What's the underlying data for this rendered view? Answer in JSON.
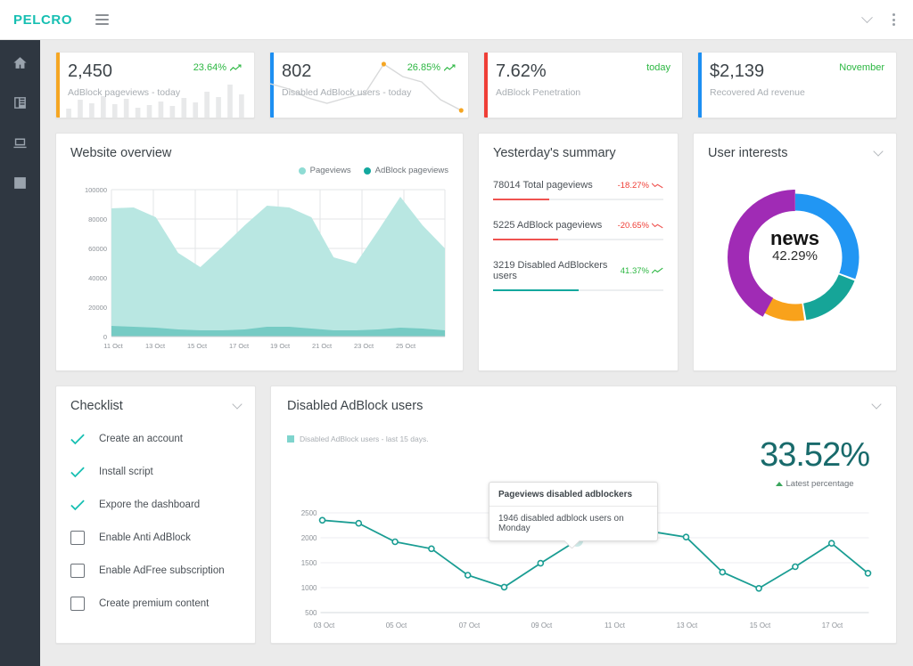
{
  "topbar": {
    "brand": "PELCRO",
    "menu_icon": "hamburger-icon",
    "chevron_icon": "chevron-down-icon",
    "kebab_icon": "more-vertical-icon"
  },
  "sidebar": {
    "items": [
      {
        "icon": "home-icon",
        "name": "sidebar-item-home"
      },
      {
        "icon": "list-icon",
        "name": "sidebar-item-content"
      },
      {
        "icon": "laptop-icon",
        "name": "sidebar-item-sites"
      },
      {
        "icon": "chart-icon",
        "name": "sidebar-item-analytics"
      }
    ]
  },
  "kpis": [
    {
      "value": "2,450",
      "delta": "23.64%",
      "delta_dir": "up",
      "label": "AdBlock pageviews - today",
      "accent": "#f5a623",
      "spark": "bars"
    },
    {
      "value": "802",
      "delta": "26.85%",
      "delta_dir": "up",
      "label": "Disabled AdBlock users - today",
      "accent": "#1d8ff2",
      "spark": "line"
    },
    {
      "value": "7.62%",
      "delta": "today",
      "delta_dir": "none",
      "label": "AdBlock Penetration",
      "accent": "#ef3e36",
      "spark": "none"
    },
    {
      "value": "$2,139",
      "delta": "November",
      "delta_dir": "none",
      "label": "Recovered Ad revenue",
      "accent": "#1d8ff2",
      "spark": "none"
    }
  ],
  "overview": {
    "title": "Website overview",
    "legend": [
      {
        "label": "Pageviews",
        "color": "#8fdcd4"
      },
      {
        "label": "AdBlock pageviews",
        "color": "#13a89e"
      }
    ]
  },
  "summary": {
    "title": "Yesterday's summary",
    "rows": [
      {
        "text": "78014 Total pageviews",
        "delta": "-18.27%",
        "dir": "down",
        "color": "#ef5350",
        "progress": 33
      },
      {
        "text": "5225 AdBlock pageviews",
        "delta": "-20.65%",
        "dir": "down",
        "color": "#ef5350",
        "progress": 38
      },
      {
        "text": "3219 Disabled AdBlockers users",
        "delta": "41.37%",
        "dir": "up",
        "color": "#13a89e",
        "progress": 50
      }
    ]
  },
  "interests": {
    "title": "User interests",
    "chevron_icon": "chevron-down-icon",
    "center_label": "news",
    "center_value": "42.29%"
  },
  "checklist": {
    "title": "Checklist",
    "chevron_icon": "chevron-down-icon",
    "items": [
      {
        "label": "Create an account",
        "done": true
      },
      {
        "label": "Install script",
        "done": true
      },
      {
        "label": "Expore the dashboard",
        "done": true
      },
      {
        "label": "Enable Anti AdBlock",
        "done": false
      },
      {
        "label": "Enable AdFree subscription",
        "done": false
      },
      {
        "label": "Create premium content",
        "done": false
      }
    ]
  },
  "adblock": {
    "title": "Disabled AdBlock users",
    "chevron_icon": "chevron-down-icon",
    "legend_label": "Disabled AdBlock users - last 15 days.",
    "percentage": "33.52%",
    "percentage_caption": "Latest percentage",
    "tooltip_title": "Pageviews disabled adblockers",
    "tooltip_body": "1946 disabled adblock users on Monday"
  },
  "chart_data": [
    {
      "type": "area",
      "title": "Website overview",
      "x": [
        "11 Oct",
        "12 Oct",
        "13 Oct",
        "14 Oct",
        "15 Oct",
        "16 Oct",
        "17 Oct",
        "18 Oct",
        "19 Oct",
        "20 Oct",
        "21 Oct",
        "22 Oct",
        "23 Oct",
        "24 Oct",
        "25 Oct",
        "26 Oct"
      ],
      "tick_labels": [
        "11 Oct",
        "13 Oct",
        "15 Oct",
        "17 Oct",
        "19 Oct",
        "21 Oct",
        "23 Oct",
        "25 Oct"
      ],
      "ylim": [
        0,
        100000
      ],
      "yticks": [
        0,
        20000,
        40000,
        60000,
        80000,
        100000
      ],
      "grid": true,
      "legend_position": "top-right",
      "xlabel": "",
      "ylabel": "",
      "series": [
        {
          "name": "Pageviews",
          "color": "#b9e7e2",
          "values": [
            87000,
            88000,
            81000,
            57000,
            47000,
            61000,
            76000,
            89000,
            88000,
            81000,
            54000,
            50000,
            72000,
            95000,
            76000,
            60000
          ]
        },
        {
          "name": "AdBlock pageviews",
          "color": "#76cbc4",
          "values": [
            7000,
            6800,
            6200,
            5000,
            4200,
            4300,
            4800,
            6600,
            6400,
            5500,
            4500,
            4200,
            5000,
            6200,
            5200,
            4200
          ]
        }
      ]
    },
    {
      "type": "pie",
      "title": "User interests",
      "labels": [
        "news",
        "blue segment",
        "teal segment",
        "orange segment"
      ],
      "values": [
        42.29,
        30.5,
        16.2,
        11.0
      ],
      "colors": [
        "#a02bb5",
        "#2196f3",
        "#16a598",
        "#f9a21b"
      ],
      "highlighted": "news",
      "center_label": "news",
      "center_value": "42.29%"
    },
    {
      "type": "line",
      "title": "Disabled AdBlock users",
      "series_name": "Disabled AdBlock users - last 15 days.",
      "color": "#1a9d93",
      "x": [
        "03 Oct",
        "04 Oct",
        "05 Oct",
        "06 Oct",
        "07 Oct",
        "08 Oct",
        "09 Oct",
        "10 Oct",
        "11 Oct",
        "12 Oct",
        "13 Oct",
        "14 Oct",
        "15 Oct",
        "16 Oct",
        "17 Oct",
        "18 Oct"
      ],
      "tick_labels": [
        "03 Oct",
        "05 Oct",
        "07 Oct",
        "09 Oct",
        "11 Oct",
        "13 Oct",
        "15 Oct",
        "17 Oct"
      ],
      "values": [
        2350,
        2290,
        1920,
        1780,
        1250,
        1010,
        1490,
        1946,
        2010,
        2130,
        2015,
        1310,
        985,
        1420,
        1890,
        1290
      ],
      "ylim": [
        500,
        2500
      ],
      "yticks": [
        500,
        1000,
        1500,
        2000,
        2500
      ],
      "grid": true,
      "highlight_index": 7,
      "xlabel": "",
      "ylabel": ""
    }
  ]
}
